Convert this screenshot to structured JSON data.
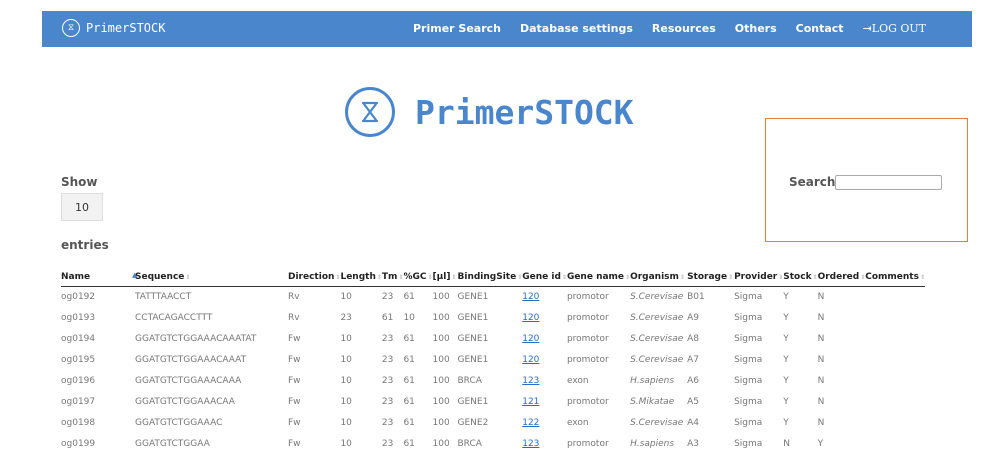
{
  "brand": {
    "name": "PrimerSTOCK",
    "logo_icon": "dna-icon"
  },
  "nav": {
    "links": [
      "Primer Search",
      "Database settings",
      "Resources",
      "Others",
      "Contact"
    ],
    "logout": "LOG OUT",
    "logout_icon": "logout-icon"
  },
  "hero": {
    "title": "PrimerSTOCK"
  },
  "length": {
    "show": "Show",
    "value": "10",
    "entries": "entries"
  },
  "search": {
    "label": "Search:",
    "value": ""
  },
  "colors": {
    "accent": "#4a86cc",
    "highlight": "#f07a2e",
    "link": "#2a6bc7"
  },
  "table": {
    "columns": [
      "Name",
      "Sequence",
      "Direction",
      "Length",
      "Tm",
      "%GC",
      "[µl]",
      "BindingSite",
      "Gene id",
      "Gene name",
      "Organism",
      "Storage",
      "Provider",
      "Stock",
      "Ordered",
      "Comments"
    ],
    "sorted_column": "Name",
    "rows": [
      [
        "og0192",
        "TATTTAACCT",
        "Rv",
        "10",
        "23",
        "61",
        "100",
        "GENE1",
        "120",
        "promotor",
        "S.Cerevisae",
        "B01",
        "Sigma",
        "Y",
        "N",
        ""
      ],
      [
        "og0193",
        "CCTACAGACCTTT",
        "Rv",
        "23",
        "61",
        "10",
        "100",
        "GENE1",
        "120",
        "promotor",
        "S.Cerevisae",
        "A9",
        "Sigma",
        "Y",
        "N",
        ""
      ],
      [
        "og0194",
        "GGATGTCTGGAAACAAATAT",
        "Fw",
        "10",
        "23",
        "61",
        "100",
        "GENE1",
        "120",
        "promotor",
        "S.Cerevisae",
        "A8",
        "Sigma",
        "Y",
        "N",
        ""
      ],
      [
        "og0195",
        "GGATGTCTGGAAACAAAT",
        "Fw",
        "10",
        "23",
        "61",
        "100",
        "GENE1",
        "120",
        "promotor",
        "S.Cerevisae",
        "A7",
        "Sigma",
        "Y",
        "N",
        ""
      ],
      [
        "og0196",
        "GGATGTCTGGAAACAAA",
        "Fw",
        "10",
        "23",
        "61",
        "100",
        "BRCA",
        "123",
        "exon",
        "H.sapiens",
        "A6",
        "Sigma",
        "Y",
        "N",
        ""
      ],
      [
        "og0197",
        "GGATGTCTGGAAACAA",
        "Fw",
        "10",
        "23",
        "61",
        "100",
        "GENE1",
        "121",
        "promotor",
        "S.Mikatae",
        "A5",
        "Sigma",
        "Y",
        "N",
        ""
      ],
      [
        "og0198",
        "GGATGTCTGGAAAC",
        "Fw",
        "10",
        "23",
        "61",
        "100",
        "GENE2",
        "122",
        "exon",
        "S.Cerevisae",
        "A4",
        "Sigma",
        "Y",
        "N",
        ""
      ],
      [
        "og0199",
        "GGATGTCTGGAA",
        "Fw",
        "10",
        "23",
        "61",
        "100",
        "BRCA",
        "123",
        "promotor",
        "H.sapiens",
        "A3",
        "Sigma",
        "N",
        "Y",
        ""
      ]
    ]
  }
}
